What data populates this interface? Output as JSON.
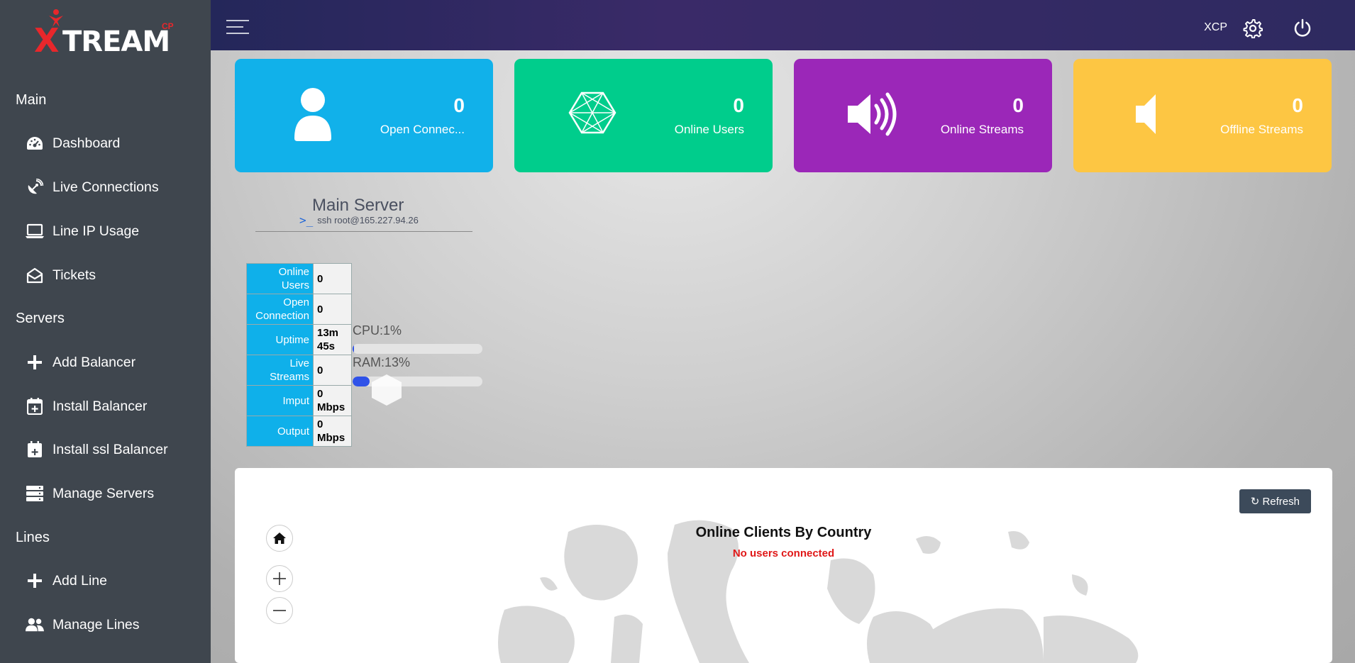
{
  "brand": {
    "logo_x": "X",
    "logo_rest": "TREAM",
    "logo_cp": "CP"
  },
  "sidebar": {
    "sections": {
      "main": "Main",
      "servers": "Servers",
      "lines": "Lines"
    },
    "items": [
      {
        "label": "Dashboard",
        "icon": "dashboard-gauge-icon"
      },
      {
        "label": "Live Connections",
        "icon": "satellite-dish-icon"
      },
      {
        "label": "Line IP Usage",
        "icon": "laptop-icon"
      },
      {
        "label": "Tickets",
        "icon": "envelope-open-icon"
      },
      {
        "label": "Add Balancer",
        "icon": "plus-icon"
      },
      {
        "label": "Install Balancer",
        "icon": "calendar-plus-icon"
      },
      {
        "label": "Install ssl Balancer",
        "icon": "calendar-plus-icon"
      },
      {
        "label": "Manage Servers",
        "icon": "server-stack-icon"
      },
      {
        "label": "Add Line",
        "icon": "plus-icon"
      },
      {
        "label": "Manage Lines",
        "icon": "users-icon"
      }
    ]
  },
  "topbar": {
    "user": "XCP"
  },
  "cards": [
    {
      "value": "0",
      "label": "Open Connec...",
      "color": "#11b1ea",
      "icon": "user-icon"
    },
    {
      "value": "0",
      "label": "Online Users",
      "color": "#00cd8c",
      "icon": "network-polygon-icon"
    },
    {
      "value": "0",
      "label": "Online Streams",
      "color": "#9b27b8",
      "icon": "volume-high-icon"
    },
    {
      "value": "0",
      "label": "Offline Streams",
      "color": "#fdc643",
      "icon": "volume-off-icon"
    }
  ],
  "server": {
    "title": "Main Server",
    "ssh": "ssh root@165.227.94.26",
    "stats": [
      {
        "key_l1": "Online",
        "key_l2": "Users",
        "val_l1": "0",
        "val_l2": ""
      },
      {
        "key_l1": "Open",
        "key_l2": "Connection",
        "val_l1": "0",
        "val_l2": ""
      },
      {
        "key_l1": "Uptime",
        "key_l2": "",
        "val_l1": "13m",
        "val_l2": "45s"
      },
      {
        "key_l1": "Live",
        "key_l2": "Streams",
        "val_l1": "0",
        "val_l2": ""
      },
      {
        "key_l1": "Imput",
        "key_l2": "",
        "val_l1": "0",
        "val_l2": "Mbps"
      },
      {
        "key_l1": "Output",
        "key_l2": "",
        "val_l1": "0",
        "val_l2": "Mbps"
      }
    ],
    "cpu_label": "CPU:1%",
    "cpu_percent": 1,
    "ram_label": "RAM:13%",
    "ram_percent": 13
  },
  "map": {
    "refresh_label": "Refresh",
    "title": "Online Clients By Country",
    "subtitle": "No users connected"
  }
}
